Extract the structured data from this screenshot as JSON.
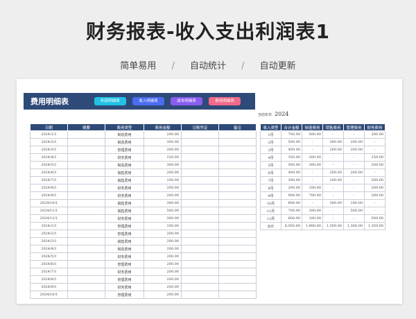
{
  "page": {
    "title": "财务报表-收入支出利润表1",
    "subtitle": [
      "简单易用",
      "自动统计",
      "自动更新"
    ],
    "separator": "/"
  },
  "sheet": {
    "banner_title": "费用明细表",
    "buttons": [
      "利润明细表",
      "收入明细表",
      "成本明细表",
      "费用明细表"
    ],
    "year_label": "当前年份",
    "year_value": "2024",
    "expense_table": {
      "headers": [
        "日期",
        "摘要",
        "费用类型",
        "费用金额",
        "记账凭证",
        "备注"
      ],
      "rows": [
        [
          "2024/1/1",
          "",
          "制造费用",
          "200.00",
          "",
          ""
        ],
        [
          "2024/2/1",
          "",
          "制造费用",
          "300.00",
          "",
          ""
        ],
        [
          "2024/3/1",
          "",
          "管理费用",
          "200.00",
          "",
          ""
        ],
        [
          "2024/4/1",
          "",
          "财务费用",
          "150.00",
          "",
          ""
        ],
        [
          "2024/5/1",
          "",
          "制造费用",
          "300.00",
          "",
          ""
        ],
        [
          "2024/6/1",
          "",
          "销售费用",
          "200.00",
          "",
          ""
        ],
        [
          "2024/7/1",
          "",
          "销售费用",
          "100.00",
          "",
          ""
        ],
        [
          "2024/8/1",
          "",
          "财务费用",
          "200.00",
          "",
          ""
        ],
        [
          "2024/9/1",
          "",
          "财务费用",
          "200.00",
          "",
          ""
        ],
        [
          "2024/10/1",
          "",
          "销售费用",
          "300.00",
          "",
          ""
        ],
        [
          "2024/11/1",
          "",
          "销售费用",
          "500.00",
          "",
          ""
        ],
        [
          "2024/12/1",
          "",
          "财务费用",
          "300.00",
          "",
          ""
        ],
        [
          "2024/1/1",
          "",
          "管理费用",
          "100.00",
          "",
          ""
        ],
        [
          "2024/2/1",
          "",
          "管理费用",
          "200.00",
          "",
          ""
        ],
        [
          "2024/3/1",
          "",
          "销售费用",
          "200.00",
          "",
          ""
        ],
        [
          "2024/4/1",
          "",
          "制造费用",
          "200.00",
          "",
          ""
        ],
        [
          "2024/5/1",
          "",
          "财务费用",
          "200.00",
          "",
          ""
        ],
        [
          "2024/6/1",
          "",
          "管理费用",
          "200.00",
          "",
          ""
        ],
        [
          "2024/7/1",
          "",
          "财务费用",
          "200.00",
          "",
          ""
        ],
        [
          "2024/8/1",
          "",
          "管理费用",
          "200.00",
          "",
          ""
        ],
        [
          "2024/9/1",
          "",
          "财务费用",
          "200.00",
          "",
          ""
        ],
        [
          "2024/10/1",
          "",
          "管理费用",
          "200.00",
          "",
          ""
        ]
      ]
    },
    "summary_table": {
      "headers": [
        "收入类型",
        "合计金额",
        "制造费用",
        "销售费用",
        "管理费用",
        "财务费用"
      ],
      "rows": [
        [
          "1月",
          "700.00",
          "500.00",
          "-",
          "-",
          "200.00"
        ],
        [
          "2月",
          "500.00",
          "-",
          "300.00",
          "200.00",
          "-"
        ],
        [
          "3月",
          "400.00",
          "-",
          "200.00",
          "200.00",
          "-"
        ],
        [
          "4月",
          "350.00",
          "200.00",
          "-",
          "-",
          "150.00"
        ],
        [
          "5月",
          "500.00",
          "300.00",
          "-",
          "-",
          "200.00"
        ],
        [
          "6月",
          "400.00",
          "-",
          "200.00",
          "200.00",
          "-"
        ],
        [
          "7月",
          "300.00",
          "-",
          "100.00",
          "-",
          "200.00"
        ],
        [
          "8月",
          "200.00",
          "100.00",
          "-",
          "-",
          "200.00"
        ],
        [
          "9月",
          "900.00",
          "700.00",
          "-",
          "-",
          "200.00"
        ],
        [
          "10月",
          "600.00",
          "-",
          "300.00",
          "100.00",
          "-"
        ],
        [
          "11月",
          "700.00",
          "200.00",
          "-",
          "500.00",
          "-"
        ],
        [
          "12月",
          "600.00",
          "100.00",
          "-",
          "-",
          "500.00"
        ],
        [
          "合计",
          "6,050.00",
          "1,900.00",
          "1,500.00",
          "1,300.00",
          "1,350.00"
        ]
      ]
    }
  }
}
